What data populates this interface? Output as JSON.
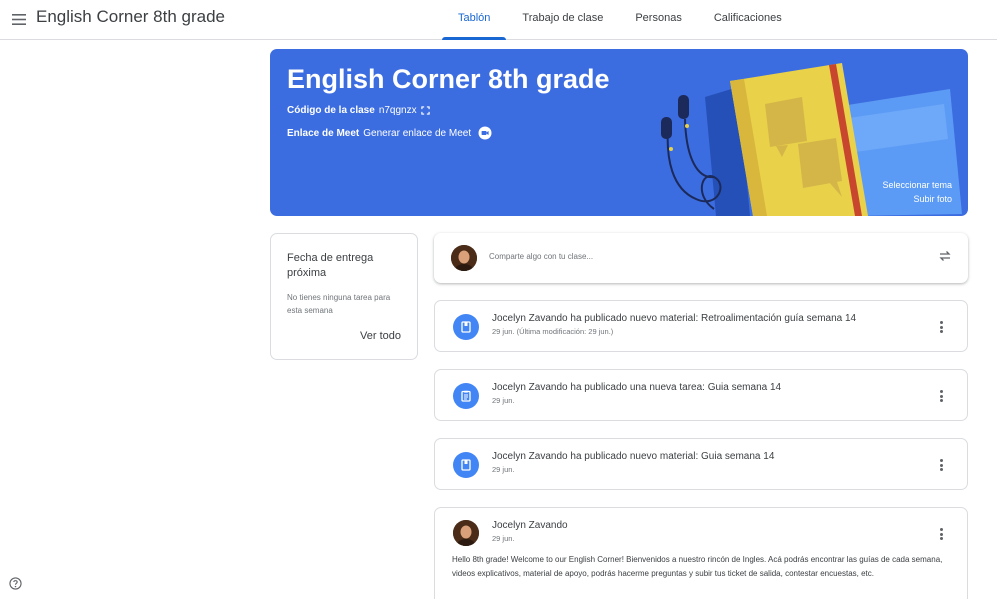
{
  "header": {
    "class_title": "English Corner 8th grade",
    "tabs": [
      {
        "label": "Tablón",
        "active": true
      },
      {
        "label": "Trabajo de clase",
        "active": false
      },
      {
        "label": "Personas",
        "active": false
      },
      {
        "label": "Calificaciones",
        "active": false
      }
    ],
    "icons": {
      "menu": "hamburger-menu-icon"
    }
  },
  "banner": {
    "title": "English Corner 8th grade",
    "class_code_label": "Código de la clase",
    "class_code": "n7qgnzx",
    "meet_label": "Enlace de Meet",
    "meet_action": "Generar enlace de Meet",
    "select_theme": "Seleccionar tema",
    "upload_photo": "Subir foto",
    "background_color": "#3c6de0"
  },
  "upcoming": {
    "title": "Fecha de entrega próxima",
    "empty_text": "No tienes ninguna tarea para esta semana",
    "view_all": "Ver todo"
  },
  "share": {
    "placeholder": "Comparte algo con tu clase..."
  },
  "stream": {
    "items": [
      {
        "icon": "material-icon",
        "title": "Jocelyn Zavando ha publicado nuevo material: Retroalimentación guía semana 14",
        "date": "29 jun. (Última modificación: 29 jun.)"
      },
      {
        "icon": "assignment-icon",
        "title": "Jocelyn Zavando ha publicado una nueva tarea: Guia semana 14",
        "date": "29 jun."
      },
      {
        "icon": "material-icon",
        "title": "Jocelyn Zavando ha publicado nuevo material: Guia semana 14",
        "date": "29 jun."
      }
    ],
    "announcement": {
      "author": "Jocelyn Zavando",
      "date": "29 jun.",
      "body": "Hello 8th grade! Welcome to our English Corner! Bienvenidos a nuestro rincón de Ingles. Acá podrás encontrar las guías de cada semana, videos explicativos, material de apoyo, podrás hacerme preguntas y subir tus ticket de salida, contestar encuestas, etc."
    }
  },
  "colors": {
    "accent": "#1967d2",
    "icon_blue": "#4285f4"
  }
}
